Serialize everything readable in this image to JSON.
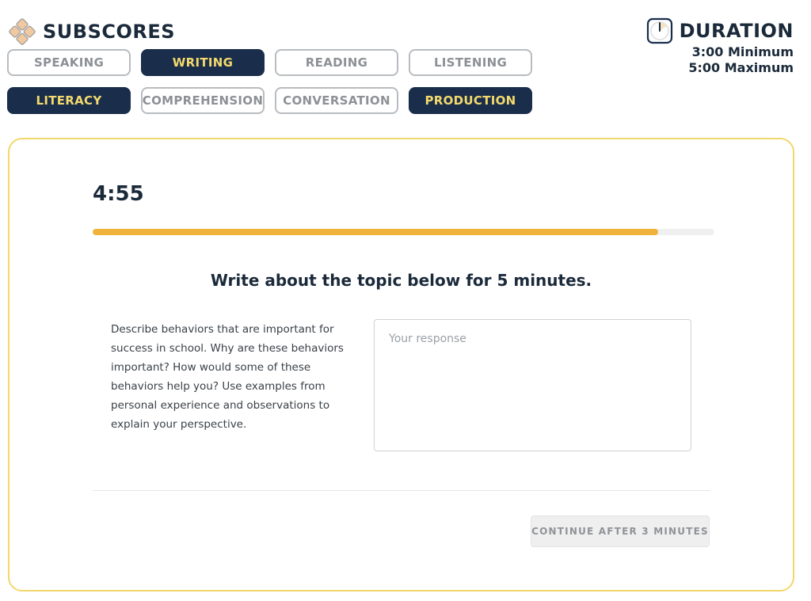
{
  "header": {
    "title": "SUBSCORES",
    "logo_icon": "diamond-grid-icon"
  },
  "subscores": [
    {
      "label": "SPEAKING",
      "active": false
    },
    {
      "label": "WRITING",
      "active": true
    },
    {
      "label": "READING",
      "active": false
    },
    {
      "label": "LISTENING",
      "active": false
    },
    {
      "label": "LITERACY",
      "active": true
    },
    {
      "label": "COMPREHENSION",
      "active": false
    },
    {
      "label": "CONVERSATION",
      "active": false
    },
    {
      "label": "PRODUCTION",
      "active": true
    }
  ],
  "duration": {
    "title": "DURATION",
    "minimum": "3:00 Minimum",
    "maximum": "5:00 Maximum",
    "icon": "clock-icon"
  },
  "task": {
    "timer": "4:55",
    "progress": 0.91,
    "heading": "Write about the topic below for 5 minutes.",
    "topic": "Describe behaviors that are important for success in school. Why are these behaviors important? How would some of these behaviors help you? Use examples from personal experience and observations to explain your perspective.",
    "response_placeholder": "Your response",
    "response_value": "",
    "continue_label": "CONTINUE AFTER 3 MINUTES"
  },
  "colors": {
    "navy": "#1a2e4c",
    "gold_text": "#f4da6c",
    "progress": "#efb23a",
    "card_border": "#f2d76a"
  }
}
